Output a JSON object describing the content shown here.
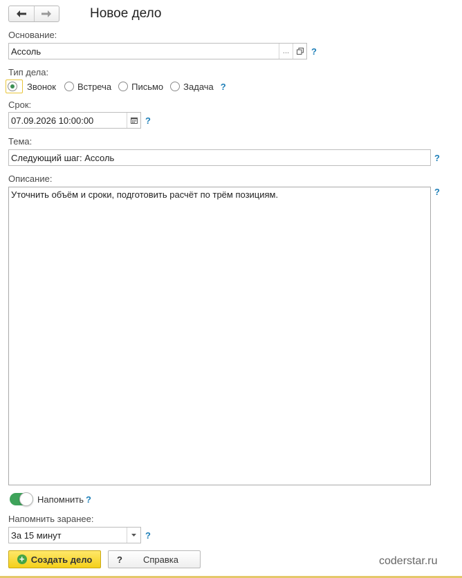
{
  "header": {
    "back_icon": "arrow-left-icon",
    "forward_icon": "arrow-right-icon",
    "title": "Новое дело"
  },
  "basis": {
    "label": "Основание:",
    "value": "Ассоль",
    "select_label": "...",
    "open_icon": "open-window-icon",
    "help": "?"
  },
  "type": {
    "label": "Тип дела:",
    "options": [
      "Звонок",
      "Встреча",
      "Письмо",
      "Задача"
    ],
    "selected": "Звонок",
    "help": "?"
  },
  "deadline": {
    "label": "Срок:",
    "value": "07.09.2026 10:00:00",
    "calendar_icon": "calendar-icon",
    "help": "?"
  },
  "subject": {
    "label": "Тема:",
    "value": "Следующий шаг: Ассоль",
    "help": "?"
  },
  "description": {
    "label": "Описание:",
    "value": "Уточнить объём и сроки, подготовить расчёт по трём позициям.",
    "help": "?"
  },
  "remind": {
    "label": "Напомнить",
    "enabled": true,
    "help": "?"
  },
  "remind_before": {
    "label": "Напомнить заранее:",
    "value": "За 15 минут",
    "help": "?"
  },
  "actions": {
    "create_label": "Создать дело",
    "help_mark": "?",
    "help_label": "Справка"
  },
  "colors": {
    "accent_green": "#3ea35a",
    "primary_yellow": "#f4d01a",
    "help_blue": "#1e7fb8"
  },
  "watermark": "coderstar.ru"
}
